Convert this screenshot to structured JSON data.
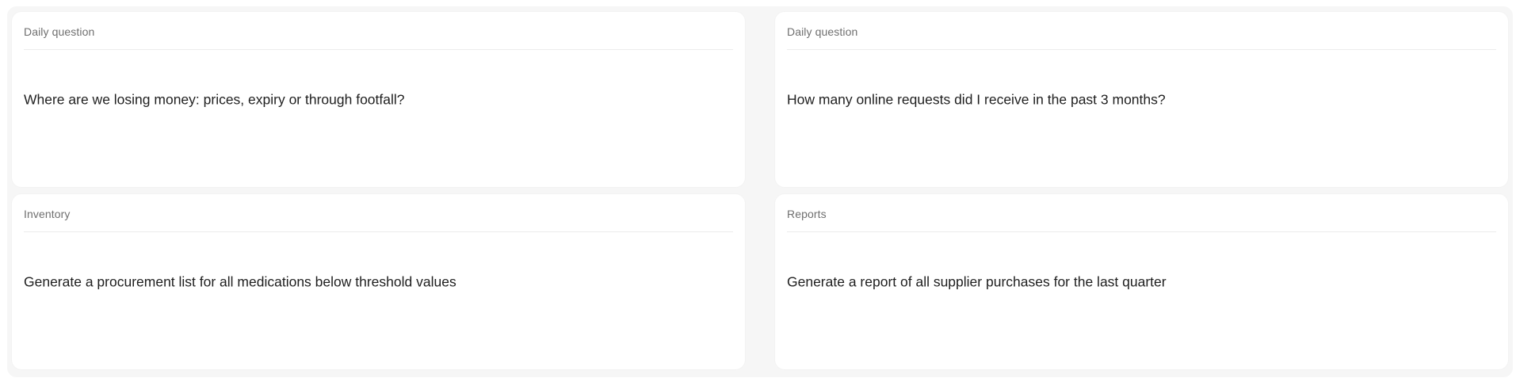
{
  "cards": [
    {
      "label": "Daily question",
      "text": "Where are we losing money: prices, expiry or through footfall?"
    },
    {
      "label": "Daily question",
      "text": "How many online requests did I receive in the past 3 months?"
    },
    {
      "label": "Inventory",
      "text": "Generate a procurement list for all medications below threshold values"
    },
    {
      "label": "Reports",
      "text": "Generate a report of all supplier purchases for the last quarter"
    }
  ]
}
